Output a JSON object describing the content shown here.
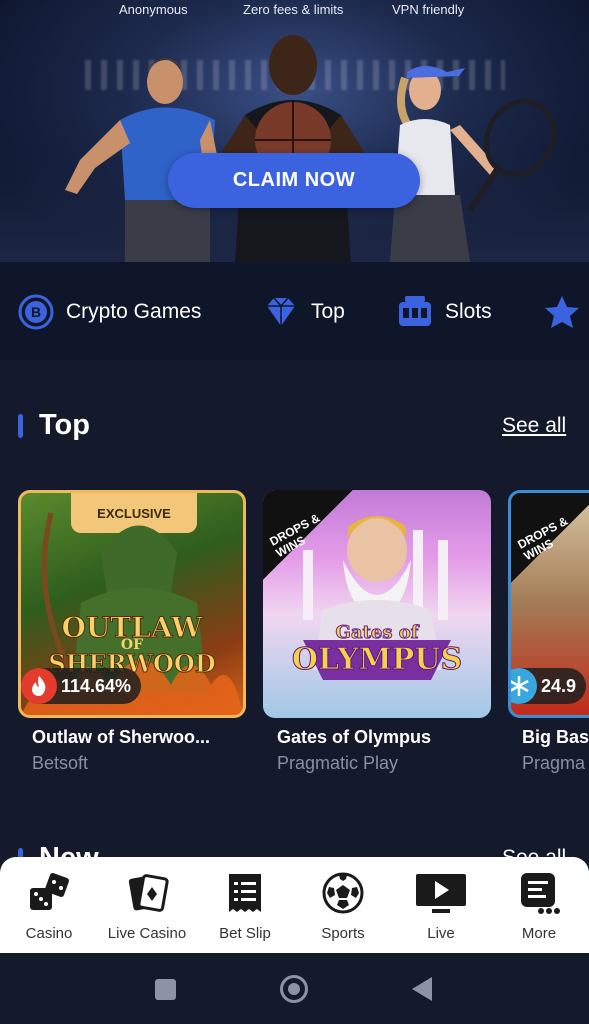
{
  "banner": {
    "features": [
      "Anonymous",
      "Zero fees & limits",
      "VPN friendly"
    ],
    "cta_label": "CLAIM NOW"
  },
  "categories": [
    {
      "label": "Crypto Games",
      "icon": "bitcoin-icon"
    },
    {
      "label": "Top",
      "icon": "diamond-icon"
    },
    {
      "label": "Slots",
      "icon": "slot-machine-icon"
    },
    {
      "label": "",
      "icon": "star-icon"
    }
  ],
  "top_section": {
    "title": "Top",
    "see_all": "See all",
    "games": [
      {
        "name": "Outlaw of Sherwoo...",
        "provider": "Betsoft",
        "badge": "EXCLUSIVE",
        "rtp": "114.64%",
        "rtp_icon": "fire-icon",
        "logo_line1": "OUTLAW",
        "logo_line2": "OF",
        "logo_line3": "SHERWOOD"
      },
      {
        "name": "Gates of Olympus",
        "provider": "Pragmatic Play",
        "ribbon": "DROPS & WINS",
        "logo_line1": "Gates of",
        "logo_line2": "OLYMPUS"
      },
      {
        "name": "Big Bas",
        "provider": "Pragma",
        "ribbon": "DROPS & WINS",
        "rtp": "24.9",
        "rtp_icon": "snowflake-icon"
      }
    ]
  },
  "new_section": {
    "title": "New",
    "see_all": "See all"
  },
  "bottom_nav": [
    {
      "label": "Casino",
      "icon": "dice-icon"
    },
    {
      "label": "Live Casino",
      "icon": "cards-icon"
    },
    {
      "label": "Bet Slip",
      "icon": "receipt-icon"
    },
    {
      "label": "Sports",
      "icon": "soccer-ball-icon"
    },
    {
      "label": "Live",
      "icon": "tv-play-icon"
    },
    {
      "label": "More",
      "icon": "more-icon"
    }
  ],
  "colors": {
    "accent": "#3b63e0",
    "background": "#141a2b",
    "hot": "#e33b2c",
    "cold": "#39a6dd",
    "exclusive": "#f3c77a"
  }
}
